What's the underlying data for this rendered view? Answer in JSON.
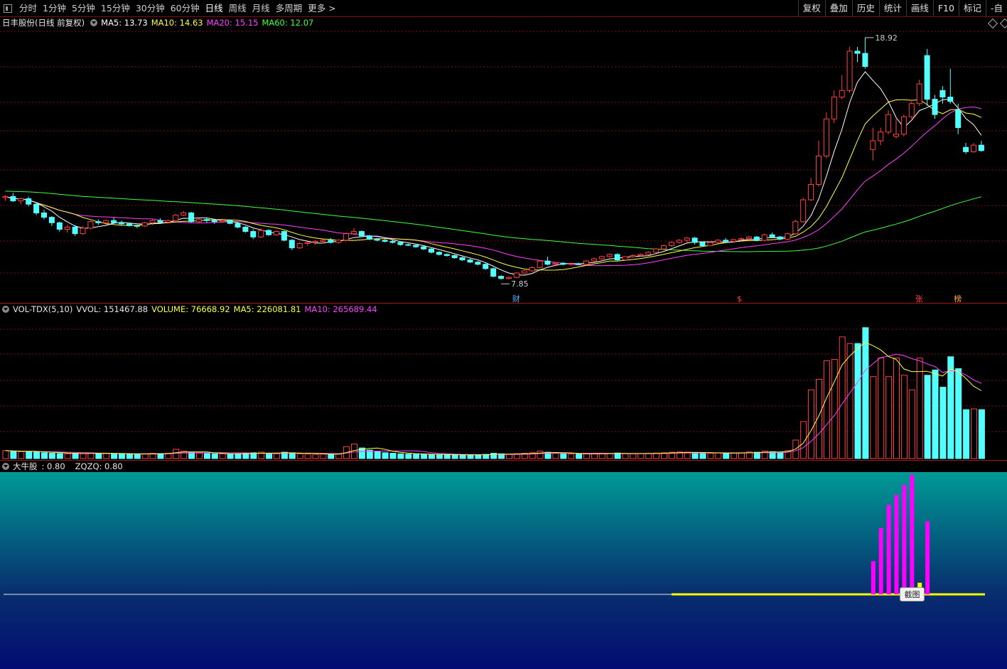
{
  "toolbar": {
    "periods": [
      "分时",
      "1分钟",
      "5分钟",
      "15分钟",
      "30分钟",
      "60分钟",
      "日线",
      "周线",
      "月线",
      "多周期",
      "更多 >"
    ],
    "active_period": "日线",
    "tools": [
      "复权",
      "叠加",
      "历史",
      "统计",
      "画线",
      "F10",
      "标记",
      "-自"
    ]
  },
  "price_panel": {
    "title": "日丰股份(日线 前复权)",
    "ma5": "MA5: 13.73",
    "ma10": "MA10: 14.63",
    "ma20": "MA20: 15.15",
    "ma60": "MA60: 12.07",
    "high_label": "18.92",
    "low_label": "7.85",
    "markers": [
      "财",
      "$",
      "张",
      "榜"
    ]
  },
  "volume_panel": {
    "indicator": "VOL-TDX(5,10)",
    "vvol": "VVOL: 151467.88",
    "volume": "VOLUME: 76668.92",
    "ma5": "MA5: 226081.81",
    "ma10": "MA10: 265689.44"
  },
  "signal_panel": {
    "name": "大牛股",
    "value": ": 0.80",
    "zqzq": "ZQZQ: 0.80"
  },
  "screenshot_button": "截图",
  "colors": {
    "up": "#ff4040",
    "down": "#54ffff",
    "ma5": "#ffffff",
    "ma10": "#ffff40",
    "ma20": "#ff40ff",
    "ma60": "#40ff40",
    "grid": "#7a1010",
    "signal": "#ff00ff",
    "signal_base": "#ffff00"
  },
  "chart_data": {
    "type": "candlestick",
    "candles": [
      [
        11.6,
        11.72,
        11.45,
        11.65
      ],
      [
        11.65,
        11.82,
        11.4,
        11.45
      ],
      [
        11.45,
        11.6,
        11.3,
        11.55
      ],
      [
        11.55,
        11.65,
        11.2,
        11.3
      ],
      [
        11.3,
        11.35,
        10.8,
        10.9
      ],
      [
        10.9,
        11.05,
        10.6,
        10.7
      ],
      [
        10.7,
        10.75,
        10.3,
        10.45
      ],
      [
        10.45,
        10.5,
        10.05,
        10.15
      ],
      [
        10.15,
        10.35,
        10.0,
        10.25
      ],
      [
        10.25,
        10.35,
        9.85,
        9.95
      ],
      [
        9.95,
        10.3,
        9.9,
        10.2
      ],
      [
        10.2,
        10.55,
        10.15,
        10.5
      ],
      [
        10.5,
        10.6,
        10.35,
        10.45
      ],
      [
        10.45,
        10.6,
        10.35,
        10.55
      ],
      [
        10.55,
        10.7,
        10.4,
        10.45
      ],
      [
        10.45,
        10.55,
        10.3,
        10.4
      ],
      [
        10.4,
        10.45,
        10.28,
        10.32
      ],
      [
        10.32,
        10.35,
        10.2,
        10.3
      ],
      [
        10.3,
        10.5,
        10.25,
        10.45
      ],
      [
        10.45,
        10.6,
        10.35,
        10.55
      ],
      [
        10.55,
        10.65,
        10.4,
        10.48
      ],
      [
        10.48,
        10.6,
        10.42,
        10.55
      ],
      [
        10.55,
        10.85,
        10.5,
        10.8
      ],
      [
        10.8,
        11.0,
        10.75,
        10.9
      ],
      [
        10.9,
        10.95,
        10.45,
        10.5
      ],
      [
        10.5,
        10.65,
        10.45,
        10.6
      ],
      [
        10.6,
        10.7,
        10.45,
        10.55
      ],
      [
        10.55,
        10.6,
        10.4,
        10.5
      ],
      [
        10.5,
        10.6,
        10.45,
        10.55
      ],
      [
        10.55,
        10.6,
        10.38,
        10.42
      ],
      [
        10.42,
        10.48,
        10.2,
        10.25
      ],
      [
        10.25,
        10.3,
        10.0,
        10.05
      ],
      [
        10.05,
        10.15,
        9.7,
        9.8
      ],
      [
        9.8,
        10.2,
        9.75,
        10.1
      ],
      [
        10.1,
        10.15,
        9.85,
        9.9
      ],
      [
        9.9,
        10.1,
        9.85,
        10.05
      ],
      [
        10.05,
        10.1,
        9.6,
        9.65
      ],
      [
        9.65,
        9.7,
        9.2,
        9.3
      ],
      [
        9.3,
        9.55,
        9.25,
        9.5
      ],
      [
        9.5,
        9.6,
        9.4,
        9.55
      ],
      [
        9.55,
        9.65,
        9.45,
        9.6
      ],
      [
        9.6,
        9.7,
        9.5,
        9.65
      ],
      [
        9.65,
        9.75,
        9.5,
        9.55
      ],
      [
        9.55,
        9.7,
        9.5,
        9.65
      ],
      [
        9.65,
        10.0,
        9.6,
        9.95
      ],
      [
        9.95,
        10.2,
        9.9,
        10.05
      ],
      [
        10.05,
        10.1,
        9.8,
        9.85
      ],
      [
        9.85,
        9.9,
        9.65,
        9.7
      ],
      [
        9.7,
        9.75,
        9.6,
        9.65
      ],
      [
        9.65,
        9.7,
        9.55,
        9.6
      ],
      [
        9.6,
        9.65,
        9.5,
        9.55
      ],
      [
        9.55,
        9.6,
        9.4,
        9.45
      ],
      [
        9.45,
        9.5,
        9.38,
        9.42
      ],
      [
        9.42,
        9.45,
        9.3,
        9.35
      ],
      [
        9.35,
        9.4,
        9.2,
        9.25
      ],
      [
        9.25,
        9.3,
        9.05,
        9.1
      ],
      [
        9.1,
        9.15,
        8.95,
        9.0
      ],
      [
        9.0,
        9.05,
        8.9,
        8.95
      ],
      [
        8.95,
        9.0,
        8.8,
        8.85
      ],
      [
        8.85,
        8.9,
        8.7,
        8.75
      ],
      [
        8.75,
        8.85,
        8.6,
        8.65
      ],
      [
        8.65,
        8.7,
        8.5,
        8.55
      ],
      [
        8.55,
        8.6,
        8.3,
        8.35
      ],
      [
        8.35,
        8.4,
        7.95,
        8.0
      ],
      [
        8.0,
        8.05,
        7.85,
        7.9
      ],
      [
        7.9,
        7.98,
        7.85,
        7.95
      ],
      [
        7.95,
        8.2,
        7.9,
        8.15
      ],
      [
        8.15,
        8.3,
        8.1,
        8.25
      ],
      [
        8.25,
        8.45,
        8.2,
        8.4
      ],
      [
        8.4,
        8.75,
        8.35,
        8.7
      ],
      [
        8.7,
        8.9,
        8.5,
        8.55
      ],
      [
        8.55,
        8.65,
        8.45,
        8.6
      ],
      [
        8.6,
        8.65,
        8.5,
        8.55
      ],
      [
        8.55,
        8.62,
        8.48,
        8.58
      ],
      [
        8.58,
        8.62,
        8.5,
        8.55
      ],
      [
        8.55,
        8.75,
        8.52,
        8.7
      ],
      [
        8.7,
        8.85,
        8.65,
        8.8
      ],
      [
        8.8,
        8.95,
        8.75,
        8.9
      ],
      [
        8.9,
        9.05,
        8.85,
        9.0
      ],
      [
        9.0,
        9.05,
        8.7,
        8.75
      ],
      [
        8.75,
        8.92,
        8.72,
        8.9
      ],
      [
        8.9,
        9.0,
        8.85,
        8.95
      ],
      [
        8.95,
        9.05,
        8.9,
        9.0
      ],
      [
        9.0,
        9.15,
        8.95,
        9.1
      ],
      [
        9.1,
        9.3,
        9.05,
        9.25
      ],
      [
        9.25,
        9.45,
        9.2,
        9.4
      ],
      [
        9.4,
        9.6,
        9.35,
        9.55
      ],
      [
        9.55,
        9.7,
        9.5,
        9.65
      ],
      [
        9.65,
        9.8,
        9.55,
        9.75
      ],
      [
        9.75,
        9.8,
        9.45,
        9.55
      ],
      [
        9.55,
        9.6,
        9.35,
        9.4
      ],
      [
        9.4,
        9.6,
        9.38,
        9.55
      ],
      [
        9.55,
        9.7,
        9.5,
        9.65
      ],
      [
        9.65,
        9.75,
        9.55,
        9.6
      ],
      [
        9.6,
        9.72,
        9.55,
        9.68
      ],
      [
        9.68,
        9.78,
        9.6,
        9.72
      ],
      [
        9.72,
        9.85,
        9.65,
        9.8
      ],
      [
        9.8,
        9.85,
        9.6,
        9.65
      ],
      [
        9.65,
        9.95,
        9.6,
        9.9
      ],
      [
        9.9,
        10.0,
        9.75,
        9.8
      ],
      [
        9.8,
        9.85,
        9.65,
        9.7
      ],
      [
        9.7,
        10.0,
        9.65,
        9.95
      ],
      [
        9.95,
        10.6,
        9.9,
        10.5
      ],
      [
        10.5,
        11.6,
        10.45,
        11.5
      ],
      [
        11.5,
        12.5,
        11.45,
        12.2
      ],
      [
        12.2,
        14.2,
        12.1,
        13.5
      ],
      [
        13.5,
        15.5,
        13.4,
        15.2
      ],
      [
        15.2,
        16.5,
        15.0,
        16.2
      ],
      [
        16.2,
        17.2,
        16.1,
        16.5
      ],
      [
        16.5,
        18.5,
        16.4,
        18.3
      ],
      [
        18.3,
        18.5,
        17.8,
        18.2
      ],
      [
        18.2,
        18.92,
        17.5,
        17.6
      ],
      [
        13.8,
        14.8,
        13.3,
        14.2
      ],
      [
        14.2,
        14.8,
        14.0,
        14.6
      ],
      [
        14.6,
        15.6,
        14.5,
        15.4
      ],
      [
        14.4,
        15.2,
        14.3,
        14.5
      ],
      [
        14.5,
        15.4,
        14.4,
        15.3
      ],
      [
        15.3,
        16.0,
        15.2,
        15.9
      ],
      [
        15.9,
        17.0,
        15.8,
        16.8
      ],
      [
        18.1,
        18.4,
        15.8,
        16.1
      ],
      [
        16.1,
        16.3,
        15.2,
        15.4
      ],
      [
        16.5,
        16.7,
        15.9,
        16.2
      ],
      [
        16.2,
        17.5,
        15.9,
        16.0
      ],
      [
        15.6,
        15.9,
        14.5,
        14.8
      ],
      [
        13.9,
        14.1,
        13.6,
        13.7
      ],
      [
        13.7,
        14.1,
        13.65,
        14.0
      ],
      [
        14.0,
        14.2,
        13.7,
        13.75
      ]
    ],
    "volume": [
      3.0,
      2.8,
      2.6,
      2.7,
      2.5,
      2.2,
      2.0,
      1.9,
      1.8,
      2.0,
      1.9,
      2.1,
      2.0,
      1.9,
      1.8,
      1.7,
      1.7,
      1.6,
      1.8,
      2.0,
      1.9,
      2.0,
      3.5,
      2.8,
      2.4,
      2.0,
      1.9,
      1.8,
      1.8,
      1.7,
      1.8,
      2.0,
      2.2,
      2.4,
      2.0,
      1.8,
      2.4,
      2.2,
      1.8,
      1.7,
      1.6,
      1.7,
      1.6,
      1.7,
      4.5,
      5.5,
      4.0,
      3.2,
      2.6,
      2.2,
      2.0,
      1.8,
      1.7,
      1.6,
      1.6,
      1.5,
      1.5,
      1.4,
      1.4,
      1.4,
      1.4,
      1.5,
      1.6,
      2.0,
      1.8,
      1.6,
      1.8,
      2.0,
      2.2,
      2.8,
      2.4,
      2.0,
      1.8,
      1.7,
      1.7,
      1.8,
      1.9,
      2.0,
      1.9,
      2.1,
      1.8,
      1.8,
      1.9,
      2.0,
      2.1,
      2.2,
      2.4,
      2.5,
      2.4,
      2.2,
      2.0,
      2.0,
      2.1,
      2.0,
      2.1,
      2.2,
      2.5,
      2.4,
      2.8,
      2.6,
      2.4,
      3.0,
      7.0,
      14.0,
      26.0,
      30.0,
      37.0,
      37.5,
      46.0,
      43.5,
      43.5,
      49.5,
      31.0,
      38.0,
      31.0,
      38.0,
      31.5,
      26.0,
      38.0,
      31.5,
      33.5,
      27.0,
      38.5,
      34.0,
      18.5,
      18.8,
      18.5
    ],
    "signal": [
      [
        112,
        1
      ],
      [
        113,
        2
      ],
      [
        114,
        2.7
      ],
      [
        115,
        3
      ],
      [
        116,
        3.3
      ],
      [
        117,
        3.6
      ],
      [
        118,
        0.35
      ],
      [
        119,
        2.2
      ]
    ]
  }
}
